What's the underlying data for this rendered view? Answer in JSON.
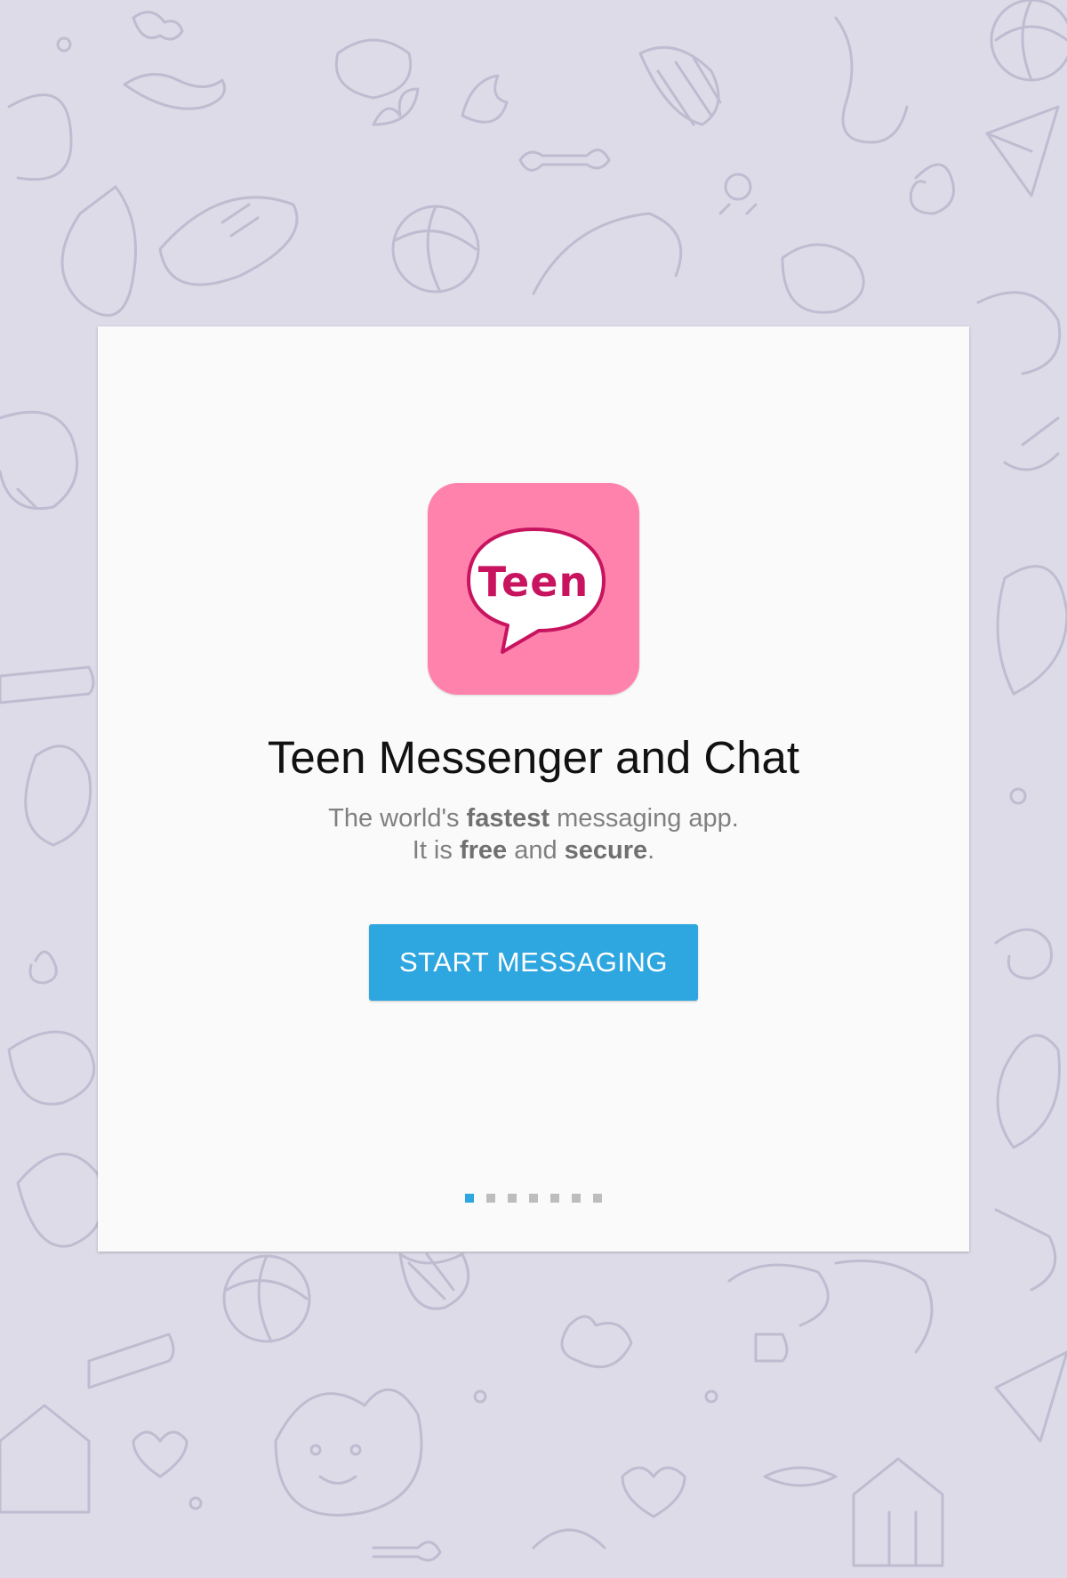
{
  "background": {
    "color": "#dedbe8",
    "pattern": "doodle-pattern"
  },
  "intro": {
    "app_icon": {
      "name": "teen-messenger-app-icon",
      "text": "Teen",
      "color": "#ff82ad",
      "text_color": "#c8145f"
    },
    "title": "Teen Messenger and Chat",
    "subtitle_line1": {
      "prefix": "The world's ",
      "bold": "fastest",
      "suffix": " messaging app."
    },
    "subtitle_line2": {
      "prefix": "It is ",
      "bold1": "free",
      "middle": " and ",
      "bold2": "secure",
      "suffix": "."
    },
    "start_button_label": "START MESSAGING",
    "accent_color": "#2ea6e0"
  },
  "pager": {
    "total_pages": 7,
    "current_page": 1
  }
}
